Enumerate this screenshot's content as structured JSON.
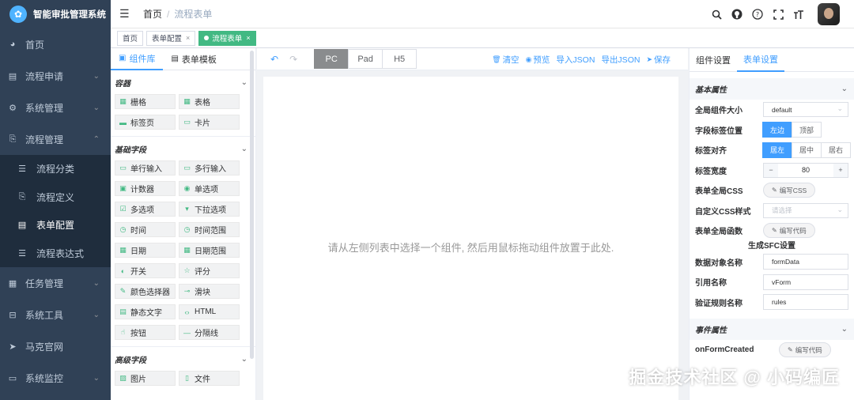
{
  "app": {
    "title": "智能审批管理系统"
  },
  "sidebar": {
    "items": [
      {
        "label": "首页",
        "icon": "dashboard-icon"
      },
      {
        "label": "流程申请",
        "icon": "document-icon"
      },
      {
        "label": "系统管理",
        "icon": "gear-icon"
      },
      {
        "label": "流程管理",
        "icon": "flow-icon"
      },
      {
        "label": "任务管理",
        "icon": "task-icon"
      },
      {
        "label": "系统工具",
        "icon": "tool-icon"
      },
      {
        "label": "马克官网",
        "icon": "send-icon"
      },
      {
        "label": "系统监控",
        "icon": "monitor-icon"
      }
    ],
    "sub_items": [
      {
        "label": "流程分类",
        "icon": "list-icon"
      },
      {
        "label": "流程定义",
        "icon": "flow-icon"
      },
      {
        "label": "表单配置",
        "icon": "form-icon"
      },
      {
        "label": "流程表达式",
        "icon": "list-icon"
      }
    ]
  },
  "navbar": {
    "breadcrumb": {
      "home": "首页",
      "current": "流程表单"
    }
  },
  "tags": [
    {
      "label": "首页"
    },
    {
      "label": "表单配置"
    },
    {
      "label": "流程表单"
    }
  ],
  "left_panel": {
    "tabs": [
      "组件库",
      "表单模板"
    ],
    "sections": {
      "container": {
        "title": "容器",
        "items": [
          "栅格",
          "表格",
          "标签页",
          "卡片"
        ]
      },
      "basic": {
        "title": "基础字段",
        "items": [
          "单行输入",
          "多行输入",
          "计数器",
          "单选项",
          "多选项",
          "下拉选项",
          "时间",
          "时间范围",
          "日期",
          "日期范围",
          "开关",
          "评分",
          "颜色选择器",
          "滑块",
          "静态文字",
          "HTML",
          "按钮",
          "分隔线"
        ]
      },
      "advanced": {
        "title": "高级字段",
        "items": [
          "图片",
          "文件"
        ]
      }
    }
  },
  "toolbar": {
    "devices": [
      "PC",
      "Pad",
      "H5"
    ],
    "actions": [
      "清空",
      "预览",
      "导入JSON",
      "导出JSON",
      "保存"
    ]
  },
  "canvas": {
    "hint": "请从左侧列表中选择一个组件, 然后用鼠标拖动组件放置于此处."
  },
  "right_panel": {
    "tabs": [
      "组件设置",
      "表单设置"
    ],
    "basic_title": "基本属性",
    "size_label": "全局组件大小",
    "size_value": "default",
    "label_pos_label": "字段标签位置",
    "label_pos_options": [
      "左边",
      "顶部"
    ],
    "label_align_label": "标签对齐",
    "label_align_options": [
      "居左",
      "居中",
      "居右"
    ],
    "label_width_label": "标签宽度",
    "label_width_value": "80",
    "css_label": "表单全局CSS",
    "css_button": "编写CSS",
    "custom_css_label": "自定义CSS样式",
    "custom_css_placeholder": "请选择",
    "func_label": "表单全局函数",
    "func_button": "编写代码",
    "sfc_title": "生成SFC设置",
    "data_obj_label": "数据对象名称",
    "data_obj_value": "formData",
    "ref_label": "引用名称",
    "ref_value": "vForm",
    "rules_label": "验证规则名称",
    "rules_value": "rules",
    "event_title": "事件属性",
    "event_label": "onFormCreated",
    "event_button": "编写代码"
  },
  "watermark": "掘金技术社区 @ 小码编匠",
  "colors": {
    "sidebar_bg": "#304156",
    "accent": "#409eff",
    "tag_active": "#42b983"
  }
}
